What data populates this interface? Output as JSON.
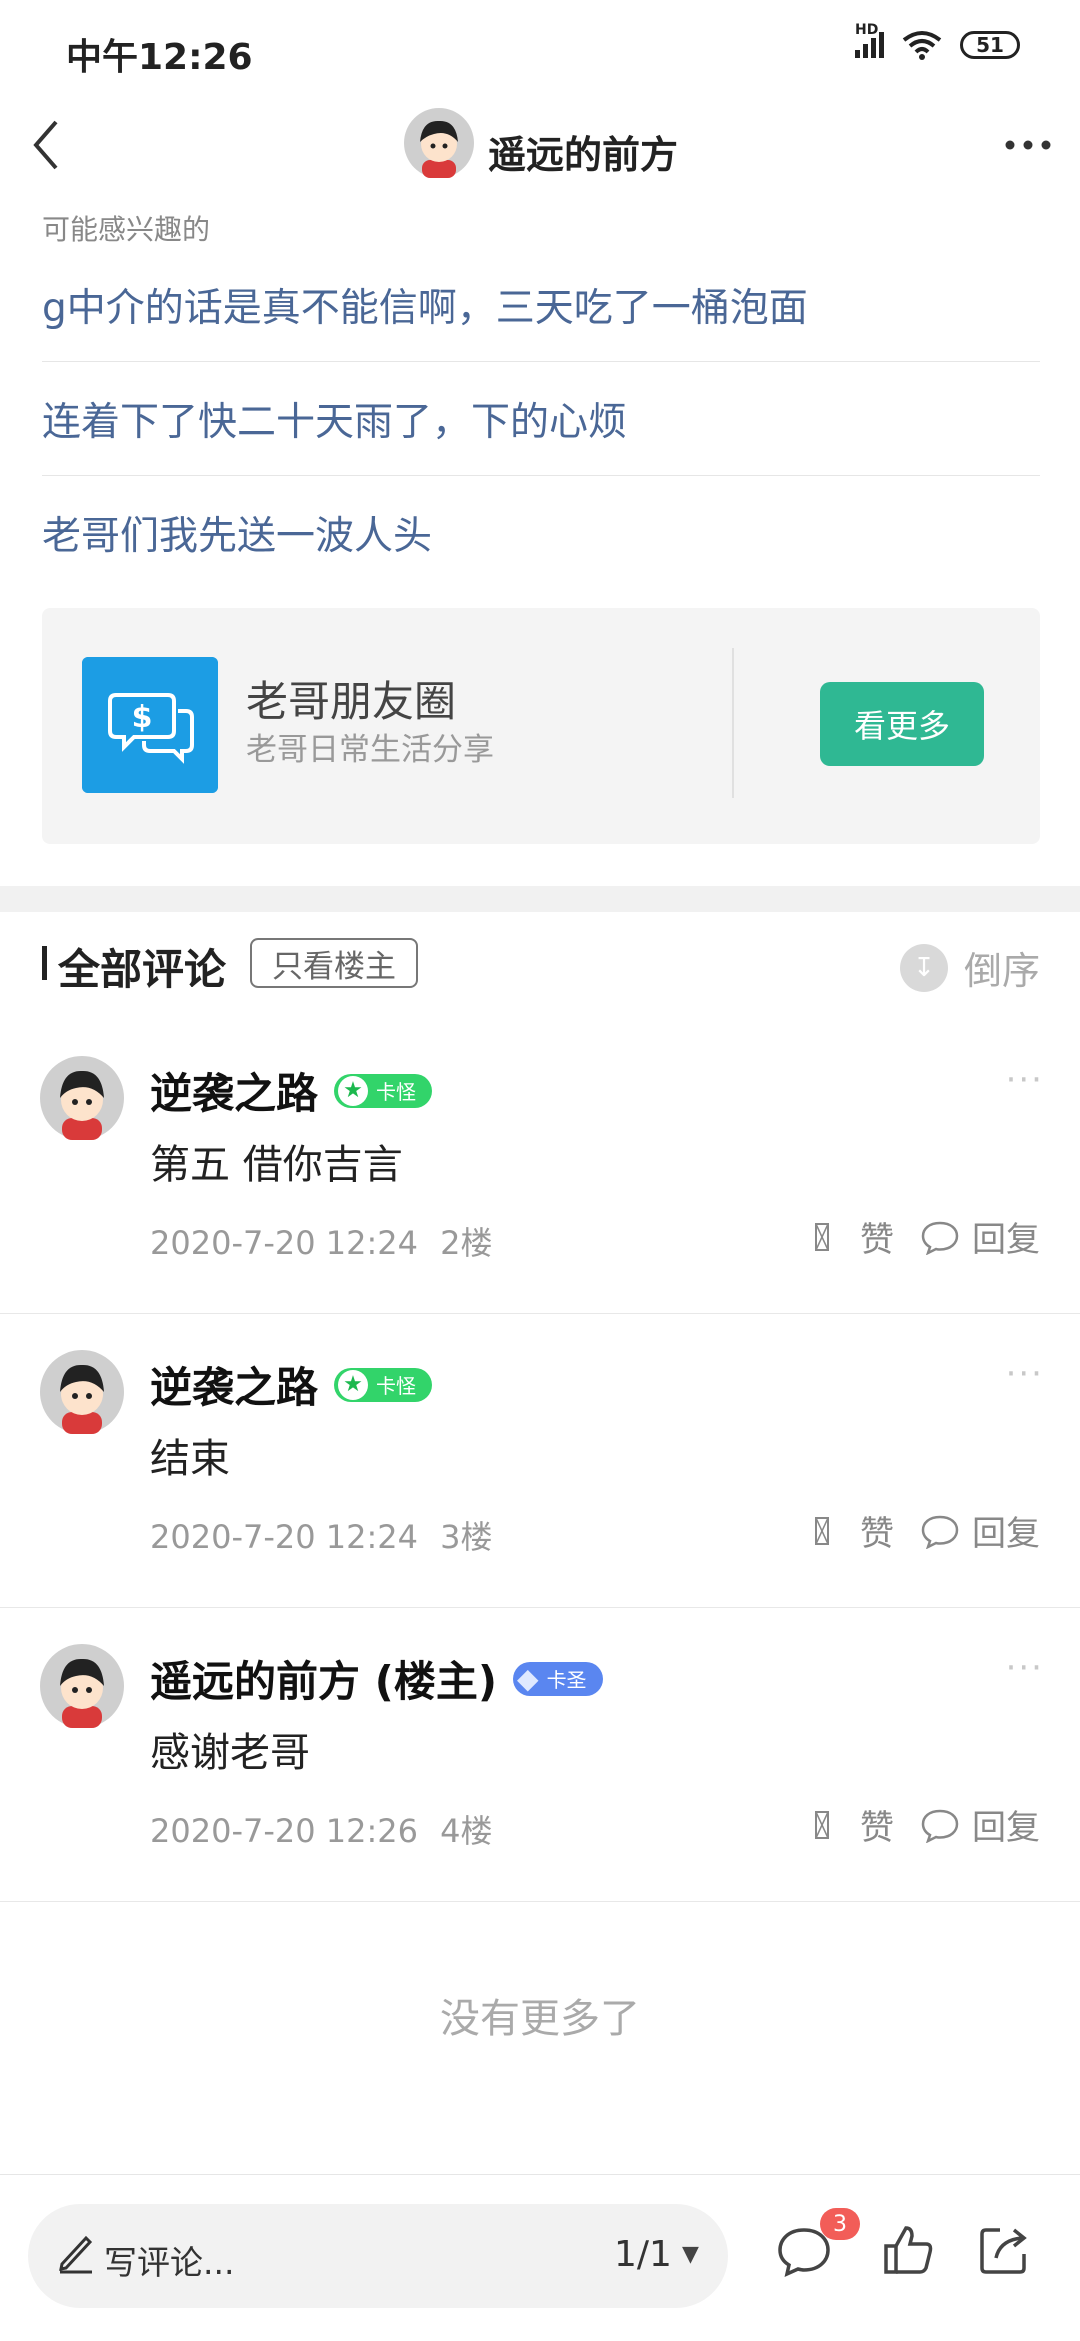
{
  "status_bar": {
    "time": "中午12:26",
    "network": "HD",
    "battery": "51"
  },
  "nav": {
    "title": "遥远的前方"
  },
  "recommend": {
    "header": "可能感兴趣的",
    "items": [
      "g中介的话是真不能信啊，三天吃了一桶泡面",
      "连着下了快二十天雨了，下的心烦",
      "老哥们我先送一波人头"
    ]
  },
  "circle_card": {
    "name": "老哥朋友圈",
    "description": "老哥日常生活分享",
    "button": "看更多"
  },
  "comments_header": {
    "title": "全部评论",
    "filter_button": "只看楼主",
    "sort_label": "倒序"
  },
  "comments": [
    {
      "author": "逆袭之路",
      "badge": "卡怪",
      "text": "第五 借你吉言",
      "date": "2020-7-20 12:24",
      "floor": "2楼",
      "like_label": "赞",
      "reply_label": "回复"
    },
    {
      "author": "逆袭之路",
      "badge": "卡怪",
      "text": "结束",
      "date": "2020-7-20 12:24",
      "floor": "3楼",
      "like_label": "赞",
      "reply_label": "回复"
    },
    {
      "author": "遥远的前方 (楼主)",
      "badge": "卡圣",
      "text": "感谢老哥",
      "date": "2020-7-20 12:26",
      "floor": "4楼",
      "like_label": "赞",
      "reply_label": "回复"
    }
  ],
  "footer": {
    "no_more": "没有更多了",
    "input_placeholder": "写评论...",
    "page_indicator": "1/1",
    "message_count": "3"
  },
  "colors": {
    "accent_green": "#2fb893",
    "link_blue": "#4a6796",
    "badge_red": "#f25d58"
  }
}
